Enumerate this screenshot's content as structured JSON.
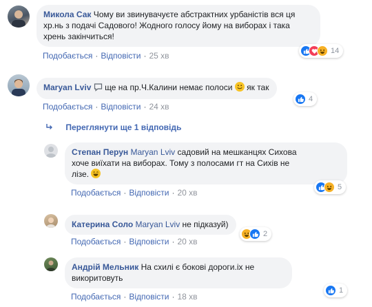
{
  "reactions_palette": {
    "like": "#1877f2",
    "love": "#f33e58",
    "haha": "#f7b125"
  },
  "comments": [
    {
      "author": "Микола Сак",
      "line1": "Чому ви звинувачуєте абстрактних урбаністів вся ця",
      "line2": "хр.нь з подачі Садового! Жодного голосу йому на виборах і така",
      "line3": "хрень закінчиться!",
      "like": "Подобається",
      "reply": "Відповісти",
      "time": "25 хв",
      "reaction_icons": [
        "like-icon",
        "love-icon",
        "haha-icon"
      ],
      "reaction_count": "14"
    },
    {
      "author": "Maryan Lviv",
      "text": "ще на пр.Ч.Калини немає полоси",
      "text_after": "як так",
      "like": "Подобається",
      "reply": "Відповісти",
      "time": "24 хв",
      "reaction_icons": [
        "like-icon"
      ],
      "reaction_count": "4"
    }
  ],
  "more_replies": "Переглянути ще 1 відповідь",
  "replies": [
    {
      "author": "Степан Перун",
      "mention": "Maryan Lviv",
      "line1": "садовий на мешканцях Сихова",
      "line2": "хоче виїхати на виборах. Тому з полосами гт на Сихів не",
      "line3": "лізе.",
      "like": "Подобається",
      "reply": "Відповісти",
      "time": "20 хв",
      "reaction_icons": [
        "like-icon",
        "haha-icon"
      ],
      "reaction_count": "5"
    },
    {
      "author": "Катерина Соло",
      "mention": "Maryan Lviv",
      "text": "не підказуй)",
      "like": "Подобається",
      "reply": "Відповісти",
      "time": "20 хв",
      "reaction_icons": [
        "haha-icon",
        "like-icon"
      ],
      "reaction_count": "2"
    },
    {
      "author": "Андрій Мельник",
      "line1": "На схилі є бокові дороги.іх не",
      "line2": "викоритовуть",
      "like": "Подобається",
      "reply": "Відповісти",
      "time": "18 хв",
      "reaction_icons": [
        "like-icon"
      ],
      "reaction_count": "1"
    }
  ]
}
